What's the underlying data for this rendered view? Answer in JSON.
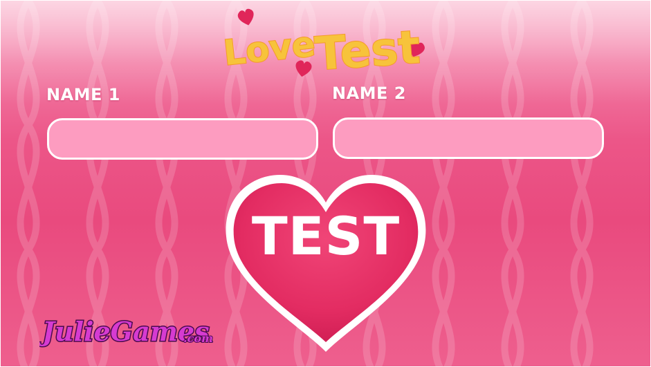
{
  "game": {
    "title_word_1": "Love",
    "title_word_2": "Test"
  },
  "form": {
    "name1_label": "NAME 1",
    "name2_label": "NAME 2",
    "name1_value": "",
    "name2_value": ""
  },
  "action": {
    "test_label": "TEST"
  },
  "brand": {
    "name": "JulieGames",
    "suffix": ".com"
  },
  "colors": {
    "background": "#e94a7e",
    "input_fill": "#fd9cc0",
    "heart_fill": "#e32c62",
    "title_yellow": "#f7c33b",
    "brand_purple": "#c030c8"
  },
  "icons": [
    "heart-icon",
    "heart-icon",
    "heart-icon",
    "heart-test-button"
  ]
}
